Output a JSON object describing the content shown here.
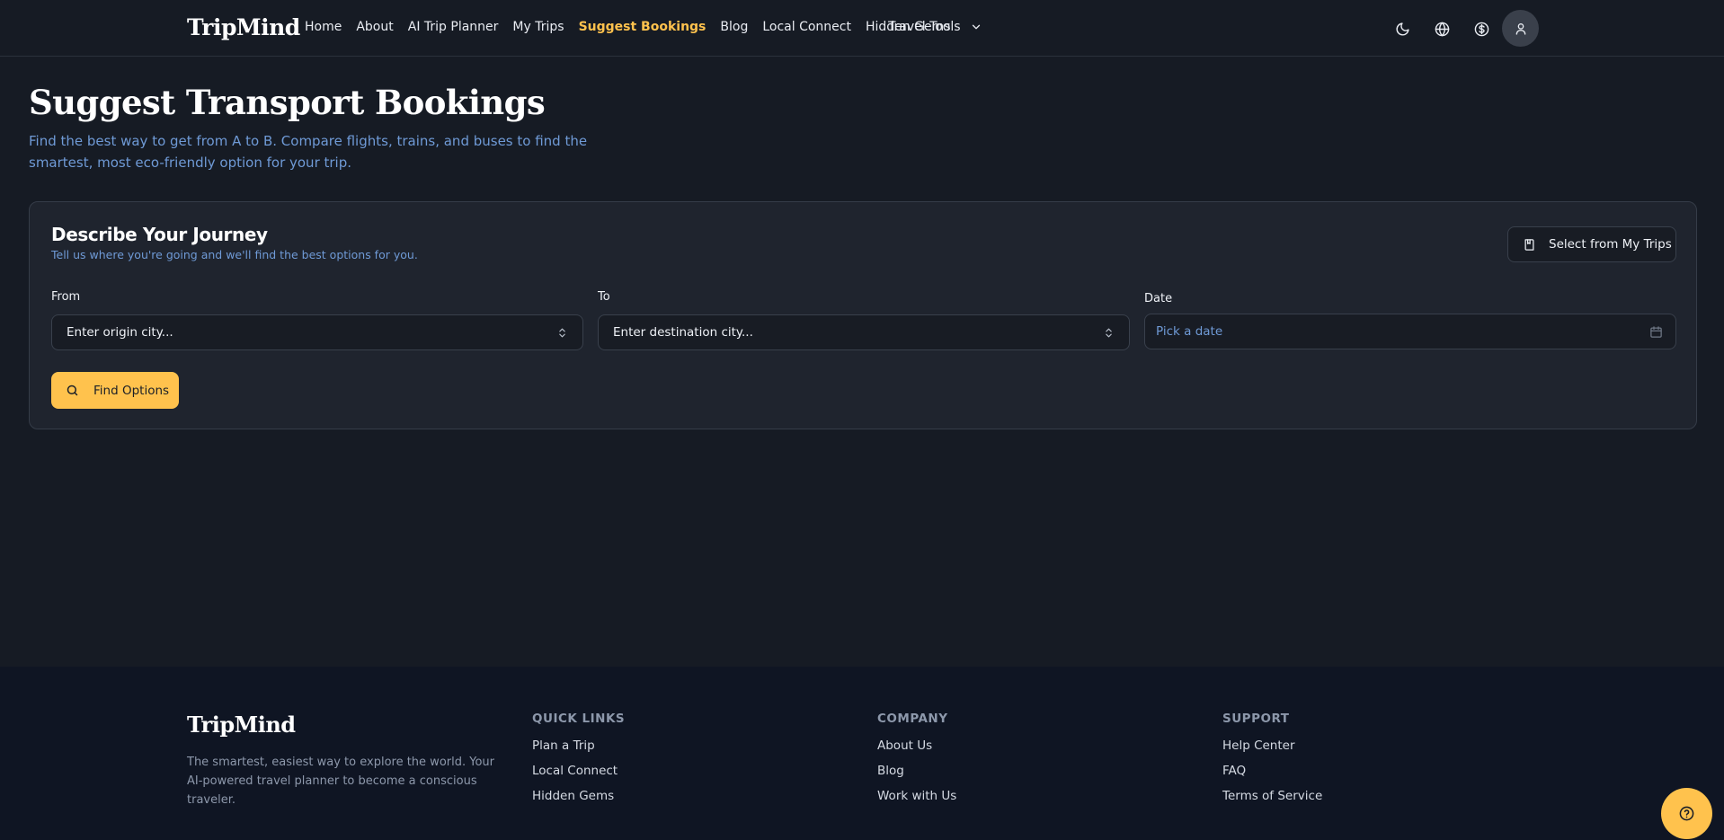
{
  "nav": {
    "brand": "TripMind",
    "links": [
      {
        "label": "Home"
      },
      {
        "label": "About"
      },
      {
        "label": "AI Trip Planner"
      },
      {
        "label": "My Trips"
      },
      {
        "label": "Suggest Bookings",
        "active": true
      },
      {
        "label": "Blog"
      },
      {
        "label": "Local Connect"
      },
      {
        "label": "Hidden Gems"
      }
    ],
    "travel_tools_label": "Travel Tools",
    "icons": [
      "moon-icon",
      "globe-icon",
      "dollar-icon",
      "user-icon"
    ]
  },
  "hero": {
    "title": "Suggest Transport Bookings",
    "subtitle": "Find the best way to get from A to B. Compare flights, trains, and buses to find the smartest, most eco-friendly option for your trip."
  },
  "journey": {
    "title": "Describe Your Journey",
    "subtitle": "Tell us where you're going and we'll find the best options for you.",
    "select_trips_label": "Select from My Trips",
    "from_label": "From",
    "from_placeholder": "Enter origin city...",
    "to_label": "To",
    "to_placeholder": "Enter destination city...",
    "date_label": "Date",
    "date_placeholder": "Pick a date",
    "find_label": "Find Options"
  },
  "footer": {
    "brand": "TripMind",
    "description": "The smartest, easiest way to explore the world. Your AI-powered travel planner to become a conscious traveler.",
    "quick_links": {
      "heading": "QUICK LINKS",
      "items": [
        "Plan a Trip",
        "Local Connect",
        "Hidden Gems"
      ]
    },
    "company": {
      "heading": "COMPANY",
      "items": [
        "About Us",
        "Blog",
        "Work with Us"
      ]
    },
    "support": {
      "heading": "SUPPORT",
      "items": [
        "Help Center",
        "FAQ",
        "Terms of Service"
      ]
    }
  },
  "colors": {
    "background": "#161b24",
    "card": "#1f242e",
    "accent": "#ffc24d",
    "muted_blue": "#6f9ad6",
    "footer_bg": "#0f1523"
  }
}
